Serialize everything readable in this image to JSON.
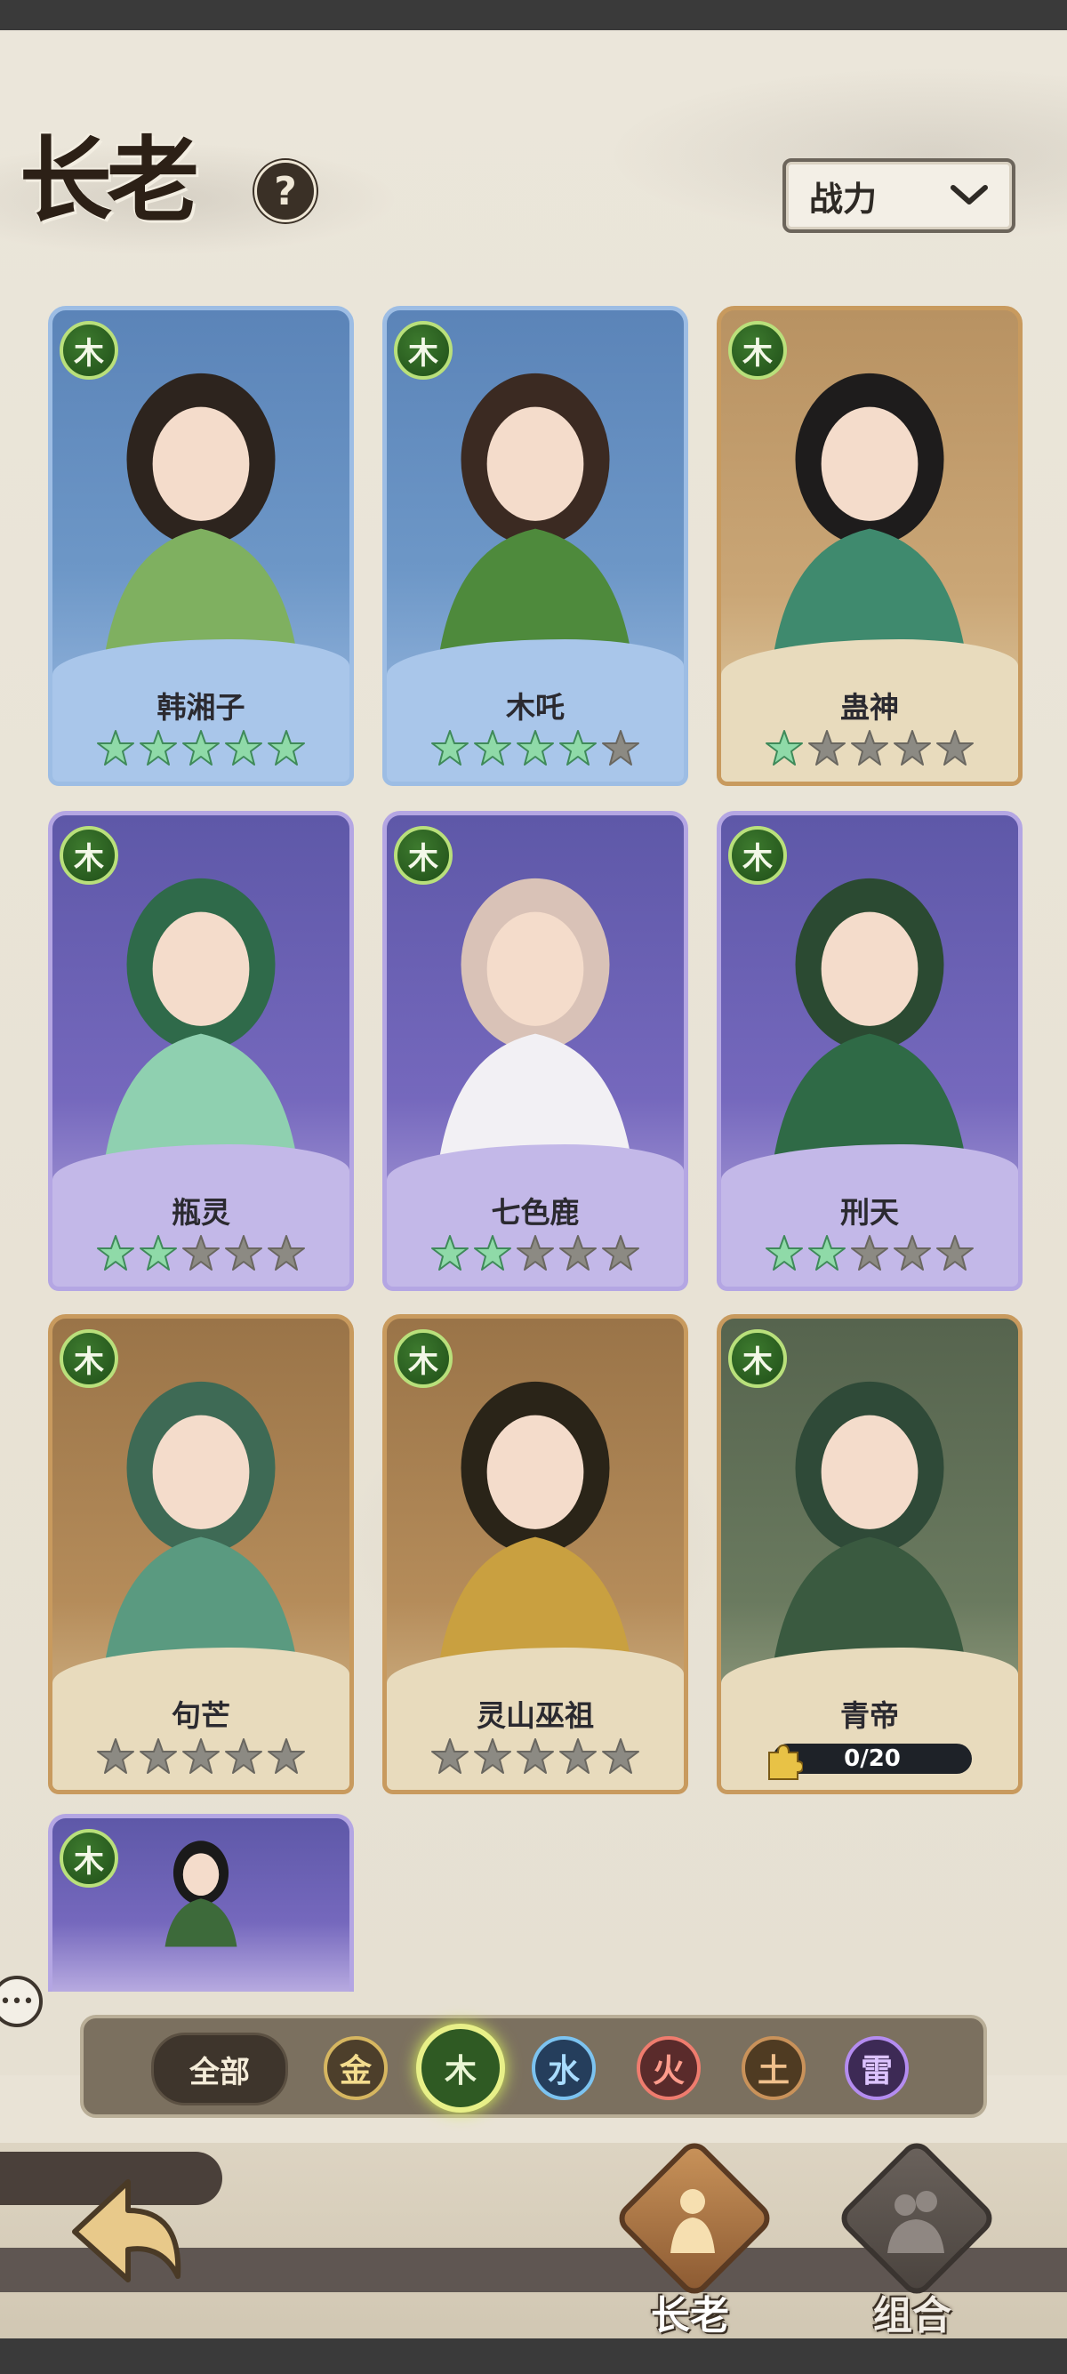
{
  "header": {
    "title": "长老",
    "help_icon": "?",
    "sort": {
      "selected": "战力",
      "icon": "chevron-down-icon"
    }
  },
  "colors": {
    "wood": "#4c9a32",
    "star_on": "#8fdaa8",
    "star_off": "#8c8a83"
  },
  "characters": [
    {
      "name": "韩湘子",
      "element": "木",
      "stars": 5,
      "frame": "blue"
    },
    {
      "name": "木吒",
      "element": "木",
      "stars": 4,
      "frame": "blue"
    },
    {
      "name": "蛊神",
      "element": "木",
      "stars": 1,
      "frame": "gold"
    },
    {
      "name": "瓶灵",
      "element": "木",
      "stars": 2,
      "frame": "purple"
    },
    {
      "name": "七色鹿",
      "element": "木",
      "stars": 2,
      "frame": "purple"
    },
    {
      "name": "刑天",
      "element": "木",
      "stars": 2,
      "frame": "purple"
    },
    {
      "name": "句芒",
      "element": "木",
      "stars": 0,
      "frame": "goldb"
    },
    {
      "name": "灵山巫祖",
      "element": "木",
      "stars": 0,
      "frame": "goldb"
    },
    {
      "name": "青帝",
      "element": "木",
      "shards": "0/20",
      "frame": "greenish"
    },
    {
      "name": "",
      "element": "木",
      "frame": "purple"
    }
  ],
  "filter": {
    "all_label": "全部",
    "elements": [
      "金",
      "木",
      "水",
      "火",
      "土",
      "雷"
    ],
    "selected": "木"
  },
  "nav": {
    "tabs": [
      {
        "label": "长老",
        "active": true
      },
      {
        "label": "组合",
        "active": false
      }
    ]
  }
}
